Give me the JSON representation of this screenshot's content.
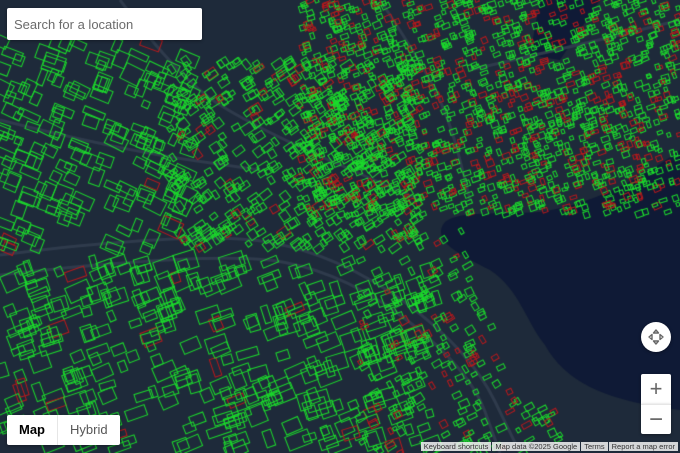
{
  "search": {
    "placeholder": "Search for a location"
  },
  "map_type": {
    "map_label": "Map",
    "hybrid_label": "Hybrid",
    "selected": "Map"
  },
  "controls": {
    "zoom_in_label": "+",
    "zoom_out_label": "−"
  },
  "attribution": {
    "keyboard": "Keyboard shortcuts",
    "data": "Map data ©2025 Google",
    "terms": "Terms",
    "report": "Report a map error"
  },
  "colors": {
    "land": "#1e2a3a",
    "water": "#0f1a36",
    "road": "#2f3b4c",
    "building_outline": "#1cdc2c",
    "building_highlight": "#b8191c"
  },
  "icons": [
    "pan-icon",
    "zoom-in-icon",
    "zoom-out-icon"
  ]
}
